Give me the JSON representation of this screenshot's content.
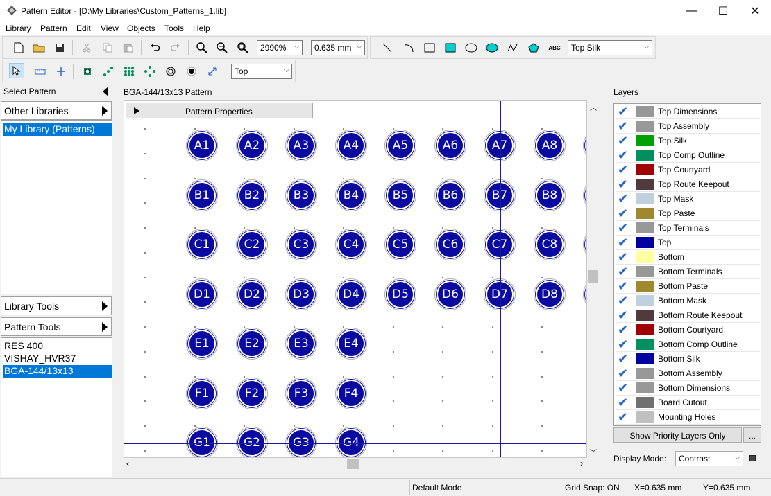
{
  "window": {
    "title": "Pattern Editor - [D:\\My Libraries\\Custom_Patterns_1.lib]",
    "controls": [
      "—",
      "☐",
      "✕"
    ]
  },
  "menu": [
    "Library",
    "Pattern",
    "Edit",
    "View",
    "Objects",
    "Tools",
    "Help"
  ],
  "toolbar": {
    "zoom": "2990%",
    "grid": "0.635 mm",
    "layer": "Top Silk",
    "side": "Top",
    "text_icon_label": "ABC"
  },
  "left_panel": {
    "header": "Select Pattern",
    "other_libraries": "Other Libraries",
    "libraries": [
      "My Library (Patterns)"
    ],
    "library_tools": "Library Tools",
    "pattern_tools": "Pattern Tools",
    "patterns": [
      "RES 400",
      "VISHAY_HVR37",
      "BGA-144/13x13"
    ]
  },
  "canvas": {
    "title": "BGA-144/13x13 Pattern",
    "properties_label": "Pattern Properties",
    "pads": [
      [
        "A1",
        "A2",
        "A3",
        "A4",
        "A5",
        "A6",
        "A7",
        "A8"
      ],
      [
        "B1",
        "B2",
        "B3",
        "B4",
        "B5",
        "B6",
        "B7",
        "B8"
      ],
      [
        "C1",
        "C2",
        "C3",
        "C4",
        "C5",
        "C6",
        "C7",
        "C8"
      ],
      [
        "D1",
        "D2",
        "D3",
        "D4",
        "D5",
        "D6",
        "D7",
        "D8"
      ],
      [
        "E1",
        "E2",
        "E3",
        "E4"
      ],
      [
        "F1",
        "F2",
        "F3",
        "F4"
      ],
      [
        "G1",
        "G2",
        "G3",
        "G4"
      ]
    ]
  },
  "layers": {
    "header": "Layers",
    "items": [
      {
        "name": "Top Dimensions",
        "color": "#989898"
      },
      {
        "name": "Top Assembly",
        "color": "#989898"
      },
      {
        "name": "Top Silk",
        "color": "#00a000"
      },
      {
        "name": "Top Comp Outline",
        "color": "#009060"
      },
      {
        "name": "Top Courtyard",
        "color": "#a00000"
      },
      {
        "name": "Top Route Keepout",
        "color": "#503a3e"
      },
      {
        "name": "Top Mask",
        "color": "#c0d0dc"
      },
      {
        "name": "Top Paste",
        "color": "#a08830"
      },
      {
        "name": "Top Terminals",
        "color": "#989898"
      },
      {
        "name": "Top",
        "color": "#0000a0"
      },
      {
        "name": "Bottom",
        "color": "#ffffa0"
      },
      {
        "name": "Bottom Terminals",
        "color": "#989898"
      },
      {
        "name": "Bottom Paste",
        "color": "#a08830"
      },
      {
        "name": "Bottom Mask",
        "color": "#c0d0dc"
      },
      {
        "name": "Bottom Route Keepout",
        "color": "#503a3e"
      },
      {
        "name": "Bottom Courtyard",
        "color": "#a00000"
      },
      {
        "name": "Bottom Comp Outline",
        "color": "#009060"
      },
      {
        "name": "Bottom Silk",
        "color": "#0000a0"
      },
      {
        "name": "Bottom Assembly",
        "color": "#989898"
      },
      {
        "name": "Bottom Dimensions",
        "color": "#989898"
      },
      {
        "name": "Board Cutout",
        "color": "#707070"
      },
      {
        "name": "Mounting Holes",
        "color": "#c0c0c0"
      }
    ],
    "show_priority_button": "Show Priority Layers Only",
    "more_button": "...",
    "display_mode_label": "Display Mode:",
    "display_mode": "Contrast"
  },
  "status": {
    "mode": "Default Mode",
    "grid_snap": "Grid Snap: ON",
    "x": "X=0.635 mm",
    "y": "Y=0.635 mm"
  }
}
